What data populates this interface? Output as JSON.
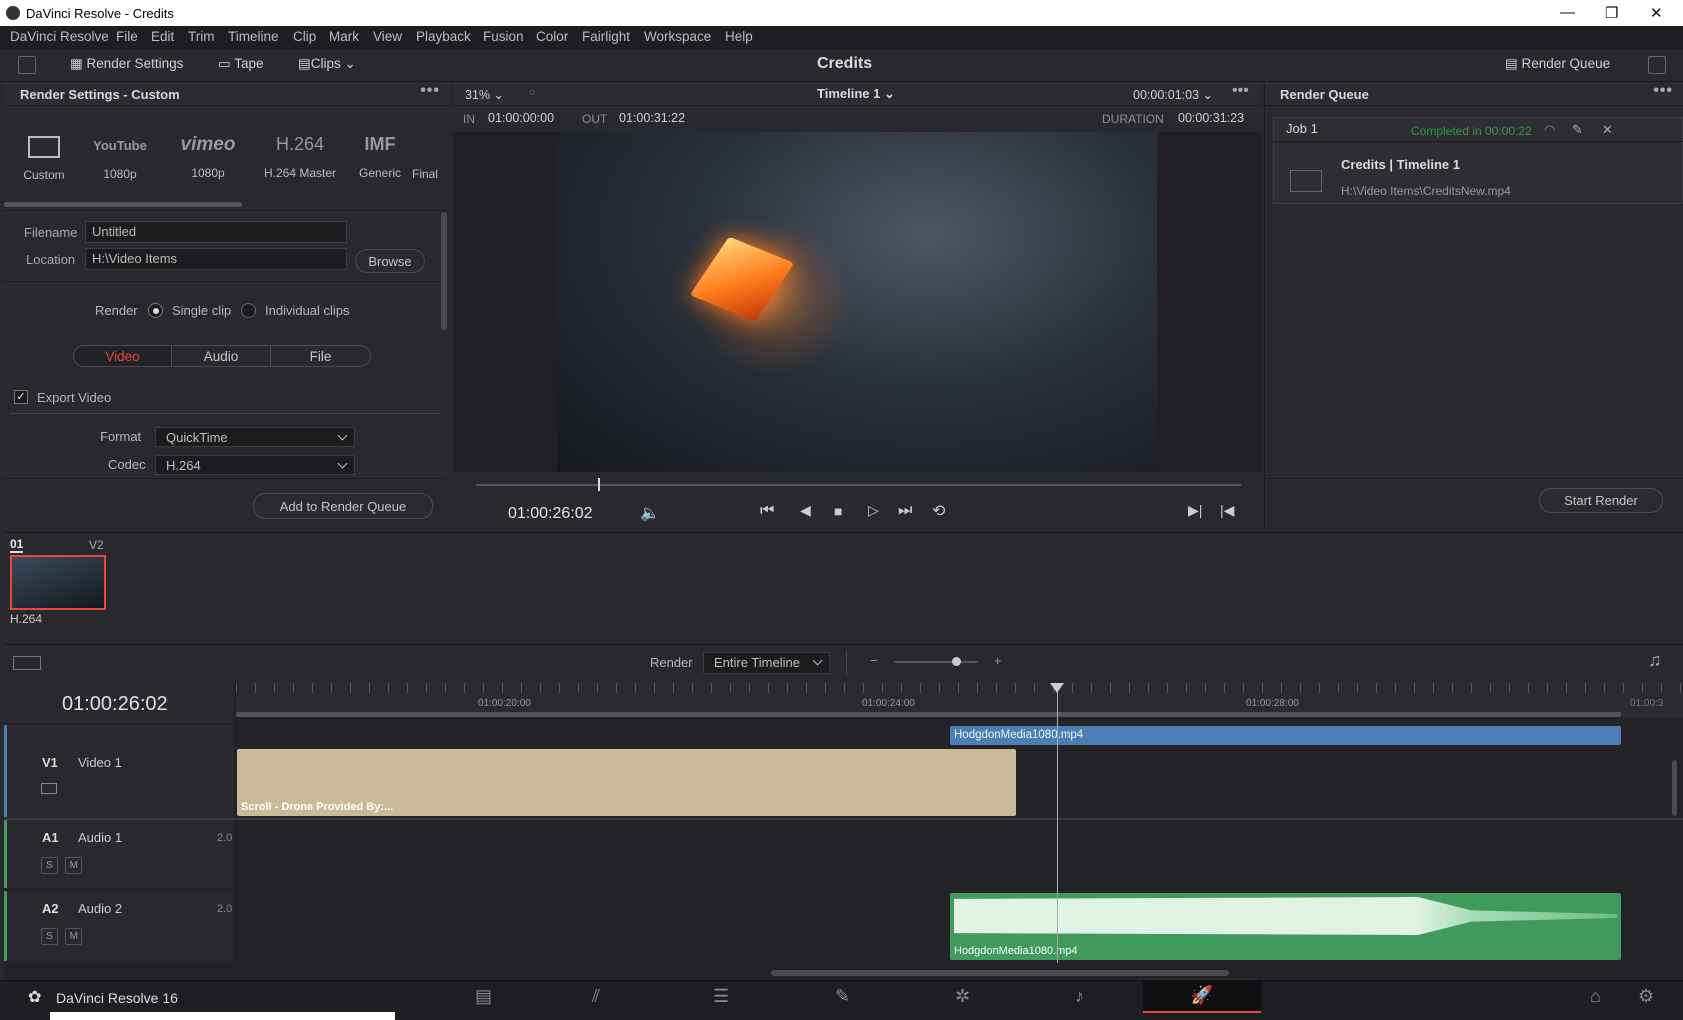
{
  "window": {
    "title": "DaVinci Resolve - Credits",
    "min": "—",
    "max": "❐",
    "close": "✕"
  },
  "menu": [
    "DaVinci Resolve",
    "File",
    "Edit",
    "Trim",
    "Timeline",
    "Clip",
    "Mark",
    "View",
    "Playback",
    "Fusion",
    "Color",
    "Fairlight",
    "Workspace",
    "Help"
  ],
  "toolbar": {
    "render_settings": "Render Settings",
    "tape": "Tape",
    "clips": "Clips",
    "project_title": "Credits",
    "render_queue": "Render Queue"
  },
  "render_settings": {
    "title": "Render Settings - Custom",
    "presets": [
      {
        "name": "Custom",
        "label": "Custom"
      },
      {
        "name": "YouTube",
        "label": "1080p"
      },
      {
        "name": "vimeo",
        "label": "1080p"
      },
      {
        "name": "H.264",
        "label": "H.264 Master"
      },
      {
        "name": "IMF",
        "label": "Generic"
      },
      {
        "name": "",
        "label": "Final"
      }
    ],
    "filename_label": "Filename",
    "filename": "Untitled",
    "location_label": "Location",
    "location": "H:\\Video Items",
    "browse": "Browse",
    "render_label": "Render",
    "single_clip": "Single clip",
    "individual_clips": "Individual clips",
    "tabs": [
      "Video",
      "Audio",
      "File"
    ],
    "export_video": "Export Video",
    "format_label": "Format",
    "format": "QuickTime",
    "codec_label": "Codec",
    "codec": "H.264",
    "add_to_queue": "Add to Render Queue"
  },
  "viewer": {
    "zoom": "31%",
    "timeline": "Timeline 1",
    "timecode_top": "00:00:01:03",
    "in_label": "IN",
    "in": "01:00:00:00",
    "out_label": "OUT",
    "out": "01:00:31:22",
    "duration_label": "DURATION",
    "duration": "00:00:31:23",
    "current_tc": "01:00:26:02"
  },
  "render_queue": {
    "title": "Render Queue",
    "job": "Job 1",
    "status": "Completed in 00:00:22",
    "job_title": "Credits | Timeline 1",
    "job_path": "H:\\Video Items\\CreditsNew.mp4",
    "start_render": "Start Render"
  },
  "clips": {
    "track_num": "01",
    "track": "V2",
    "clip_label": "H.264"
  },
  "timeline": {
    "render_label": "Render",
    "render_mode": "Entire Timeline",
    "current_tc": "01:00:26:02",
    "ruler": [
      "01:00:20:00",
      "01:00:24:00",
      "01:00:28:00",
      "01:00:3"
    ],
    "tracks": [
      {
        "id": "V1",
        "name": "Video 1",
        "ch": ""
      },
      {
        "id": "A1",
        "name": "Audio 1",
        "ch": "2.0"
      },
      {
        "id": "A2",
        "name": "Audio 2",
        "ch": "2.0"
      }
    ],
    "clip_video_top": "HodgdonMedia1080.mp4",
    "clip_video_bottom": "Scroll - Drone Provided By:...",
    "clip_audio": "HodgdonMedia1080.mp4",
    "solo": "S",
    "mute": "M"
  },
  "footer": {
    "app": "DaVinci Resolve 16"
  },
  "colors": {
    "accent_red": "#e8463c",
    "status_green": "#2e9c3c",
    "video_clip": "#c9bb9a",
    "audio_clip": "#3f9a5c",
    "blue_clip": "#4b7fb3"
  }
}
